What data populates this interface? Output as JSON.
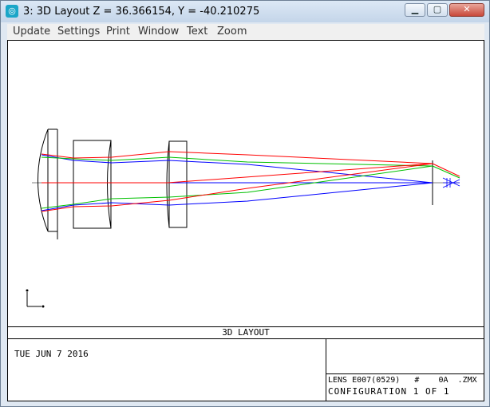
{
  "window": {
    "title": "3: 3D Layout Z = 36.366154, Y = -40.210275",
    "app_icon": "zemax-icon",
    "controls": {
      "minimize": "minimize-icon",
      "maximize": "maximize-icon",
      "close": "close-icon"
    }
  },
  "menu": {
    "items": [
      "Update",
      "Settings",
      "Print",
      "Window",
      "Text",
      "Zoom"
    ]
  },
  "plot": {
    "title": "3D LAYOUT",
    "date": "TUE JUN 7 2016",
    "lens_line": "LENS E007(0529)   #    0A  .ZMX",
    "config_line": "CONFIGURATION 1 OF 1",
    "ray_colors": {
      "field1": "#0000ff",
      "field2": "#00c000",
      "field3": "#ff0000"
    },
    "axis_icon": "axis-indicator-icon"
  }
}
